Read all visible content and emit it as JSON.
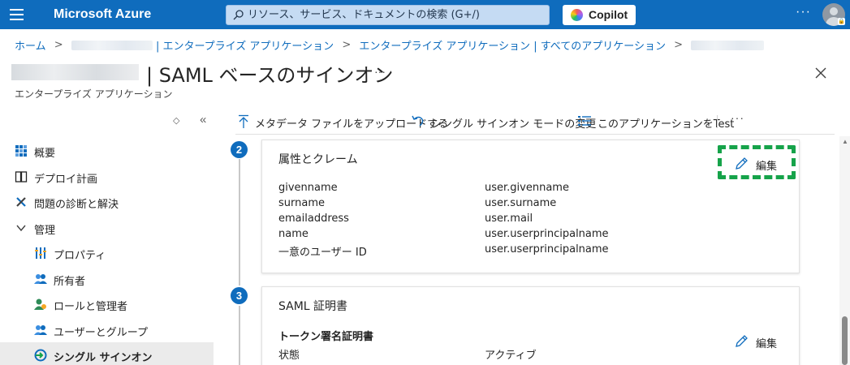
{
  "topbar": {
    "brand": "Microsoft Azure",
    "search_placeholder": "リソース、サービス、ドキュメントの検索 (G+/)",
    "copilot_label": "Copilot",
    "more": "···"
  },
  "breadcrumb": {
    "home": "ホーム",
    "app_suffix": "| エンタープライズ アプリケーション",
    "all_apps": "エンタープライズ アプリケーション | すべてのアプリケーション",
    "separator": ">"
  },
  "page": {
    "title": "| SAML ベースのサインオン",
    "subtitle": "エンタープライズ アプリケーション",
    "more": "···"
  },
  "sidebar": {
    "controls": {
      "sort": "◇",
      "collapse": "«"
    },
    "items": [
      {
        "label": "概要",
        "icon": "overview-icon"
      },
      {
        "label": "デプロイ計画",
        "icon": "book-icon"
      },
      {
        "label": "問題の診断と解決",
        "icon": "wrench-icon"
      },
      {
        "label": "管理",
        "icon": "chevron-down-icon"
      },
      {
        "label": "プロパティ",
        "icon": "properties-icon"
      },
      {
        "label": "所有者",
        "icon": "owners-icon"
      },
      {
        "label": "ロールと管理者",
        "icon": "roles-icon"
      },
      {
        "label": "ユーザーとグループ",
        "icon": "users-groups-icon"
      },
      {
        "label": "シングル サインオン",
        "icon": "sso-icon"
      }
    ]
  },
  "toolbar": {
    "upload": "メタデータ ファイルをアップロードする",
    "change_mode": "シングル サインオン モードの変更",
    "test": "このアプリケーションをTest",
    "more": "···"
  },
  "sections": {
    "attributes": {
      "step": "2",
      "title": "属性とクレーム",
      "edit_label": "編集",
      "rows": [
        {
          "key": "givenname",
          "value": "user.givenname"
        },
        {
          "key": "surname",
          "value": "user.surname"
        },
        {
          "key": "emailaddress",
          "value": "user.mail"
        },
        {
          "key": "name",
          "value": "user.userprincipalname"
        },
        {
          "key": "一意のユーザー ID",
          "value": "user.userprincipalname"
        }
      ]
    },
    "certificate": {
      "step": "3",
      "title": "SAML 証明書",
      "subheading": "トークン署名証明書",
      "edit_label": "編集",
      "status_key": "状態",
      "status_value": "アクティブ"
    }
  },
  "colors": {
    "topbar": "#0f6cbd",
    "accent": "#0f6cbd",
    "highlight": "#16a34a"
  }
}
